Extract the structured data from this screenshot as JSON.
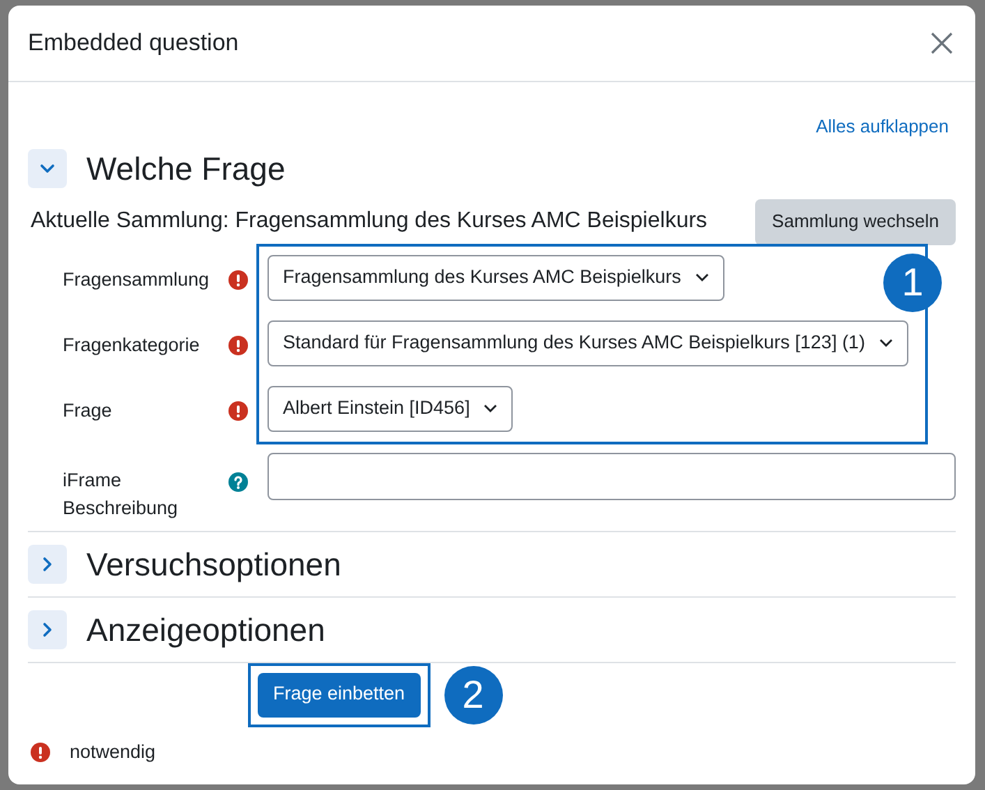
{
  "dialog": {
    "title": "Embedded question",
    "expand_all": "Alles aufklappen",
    "sections": [
      {
        "title": "Welche Frage",
        "expanded": true
      },
      {
        "title": "Versuchsoptionen",
        "expanded": false
      },
      {
        "title": "Anzeigeoptionen",
        "expanded": false
      }
    ],
    "current_collection": {
      "text": "Aktuelle Sammlung: Fragensammlung des Kurses AMC Beispielkurs",
      "button": "Sammlung wechseln"
    },
    "select_fields": [
      {
        "label": "Fragensammlung",
        "kind": "required",
        "value": "Fragensammlung des Kurses AMC Beispielkurs"
      },
      {
        "label": "Fragenkategorie",
        "kind": "required",
        "value": "Standard für Fragensammlung des Kurses AMC Beispielkurs [123] (1)"
      },
      {
        "label": "Frage",
        "kind": "required",
        "value": "Albert Einstein [ID456]"
      }
    ],
    "text_field": {
      "label": "iFrame Beschreibung",
      "kind": "help"
    },
    "fields_callout": "1",
    "submit": {
      "label": "Frage einbetten",
      "callout": "2"
    },
    "legend": "notwendig"
  }
}
